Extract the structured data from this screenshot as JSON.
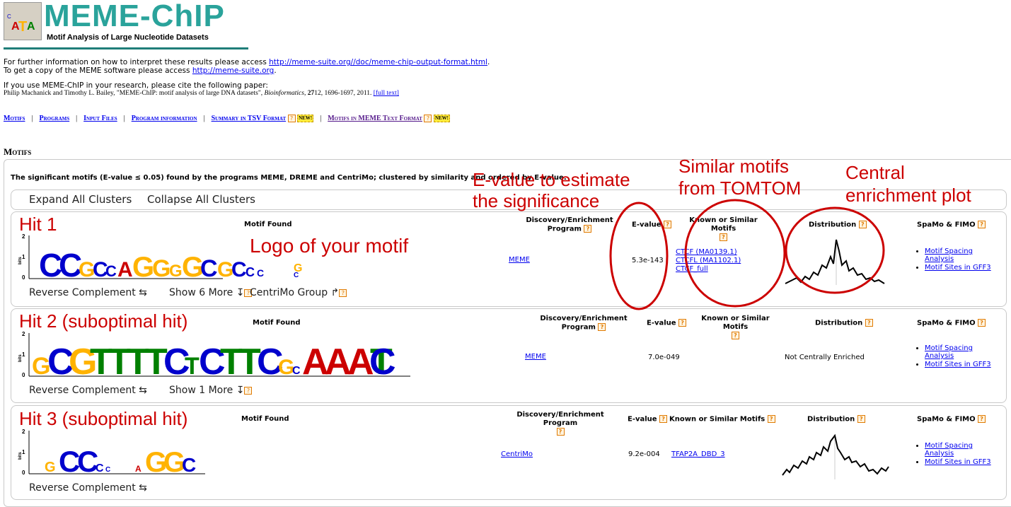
{
  "header": {
    "title": "MEME-ChIP",
    "subtitle": "Motif Analysis of Large Nucleotide Datasets"
  },
  "intro": {
    "line1_prefix": "For further information on how to interpret these results please access ",
    "line1_link": "http://meme-suite.org//doc/meme-chip-output-format.html",
    "line1_suffix": ".",
    "line2_prefix": "To get a copy of the MEME software please access ",
    "line2_link": "http://meme-suite.org",
    "line2_suffix": ".",
    "cite_line": "If you use MEME-ChIP in your research, please cite the following paper:",
    "cite_authors": "Philip Machanick and Timothy L. Bailey, \"MEME-ChIP: motif analysis of large DNA datasets\", ",
    "cite_journal": "Bioinformatics",
    "cite_sep": ", ",
    "cite_volume": "27",
    "cite_pages": "12, 1696-1697, 2011. ",
    "cite_fulltext": "[full text]"
  },
  "nav": {
    "motifs": "Motifs",
    "programs": "Programs",
    "input_files": "Input Files",
    "program_info": "Program information",
    "summary_tsv": "Summary in TSV Format",
    "motifs_meme": "Motifs in MEME Text Format",
    "new_badge": "NEW!",
    "sep": "|"
  },
  "section": {
    "title": "Motifs",
    "description": "The significant motifs (E-value ≤ 0.05) found by the programs MEME, DREME and CentriMo; clustered by similarity and ordered by E-value."
  },
  "cluster_controls": {
    "expand": "Expand All Clusters",
    "collapse": "Collapse All Clusters"
  },
  "columns": {
    "motif_found": "Motif Found",
    "discovery_a": "Discovery/Enrichment",
    "discovery_b": "Program",
    "discovery_full": "Discovery/Enrichment Program",
    "evalue": "E-value",
    "known": "Known or Similar Motifs",
    "distribution": "Distribution",
    "spamo": "SpaMo & FIMO"
  },
  "help_glyph": "?",
  "hits": [
    {
      "label": "Hit 1",
      "program": "MEME",
      "evalue": "5.3e-143",
      "known": [
        "CTCF (MA0139.1)",
        "CTCFL (MA1102.1)",
        "CTCF_full"
      ],
      "distribution": "",
      "spamo": [
        "Motif Spacing Analysis",
        "Motif Sites in GFF3"
      ],
      "controls": {
        "revcomp": "Reverse Complement ⇆",
        "more": "Show 6 More",
        "centrimo": "CentriMo Group"
      },
      "logo_letters": "CCGCCAGGGGGCGCC__GC",
      "positions": 21
    },
    {
      "label": "Hit 2 (suboptimal hit)",
      "program": "MEME",
      "evalue": "7.0e-049",
      "known": [],
      "distribution": "Not Centrally Enriched",
      "spamo": [
        "Motif Spacing Analysis",
        "Motif Sites in GFF3"
      ],
      "controls": {
        "revcomp": "Reverse Complement ⇆",
        "more": "Show 1 More"
      },
      "logo_letters": "GCGTTTTCTCTTCGCAAATCCCCCATTTAA",
      "positions": 30
    },
    {
      "label": "Hit 3 (suboptimal hit)",
      "program": "CentriMo",
      "evalue": "9.2e-004",
      "known": [
        "TFAP2A_DBD_3"
      ],
      "distribution": "",
      "spamo": [
        "Motif Spacing Analysis",
        "Motif Sites in GFF3"
      ],
      "controls": {
        "revcomp": "Reverse Complement ⇆"
      },
      "logo_letters": "GCCCCAAGGC",
      "positions": 13
    }
  ],
  "annotations": {
    "evalue_note_1": "E-value to estimate",
    "evalue_note_2": "the significance",
    "similar_note_1": "Similar motifs",
    "similar_note_2": "from TOMTOM",
    "central_note_1": "Central",
    "central_note_2": "enrichment plot",
    "logo_note": "Logo of your motif"
  },
  "colors": {
    "A": "#cc0000",
    "C": "#0000cc",
    "G": "#ffb300",
    "T": "#008000",
    "annotation": "#cc0000",
    "title_teal": "#1f7e79"
  }
}
